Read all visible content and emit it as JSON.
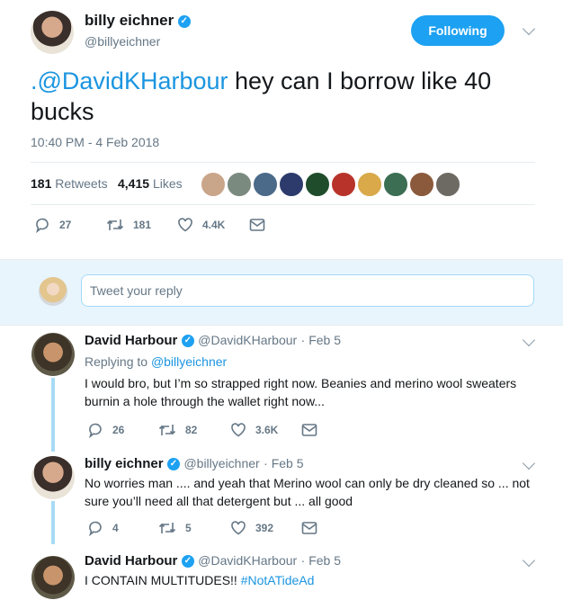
{
  "main_tweet": {
    "author_name": "billy eichner",
    "author_handle": "@billyeichner",
    "follow_button": "Following",
    "text_mention": ".@DavidKHarbour",
    "text_body": " hey can I borrow like 40 bucks",
    "timestamp": "10:40 PM - 4 Feb 2018",
    "retweets_count": "181",
    "retweets_label": "Retweets",
    "likes_count": "4,415",
    "likes_label": "Likes",
    "liker_avatar_count": 10,
    "actions": {
      "replies": "27",
      "retweets": "181",
      "likes": "4.4K"
    }
  },
  "reply_box": {
    "placeholder": "Tweet your reply"
  },
  "replies": [
    {
      "author_name": "David Harbour",
      "author_handle": "@DavidKHarbour",
      "date": "· Feb 5",
      "replying_prefix": "Replying to",
      "replying_to": "@billyeichner",
      "text": "I would bro, but I’m so strapped right now.  Beanies and merino wool sweaters burnin a hole through the wallet right now...",
      "actions": {
        "replies": "26",
        "retweets": "82",
        "likes": "3.6K"
      }
    },
    {
      "author_name": "billy eichner",
      "author_handle": "@billyeichner",
      "date": "· Feb 5",
      "text": "No worries man .... and yeah that Merino wool can only be dry cleaned so ... not sure you’ll need all that detergent but ... all good",
      "actions": {
        "replies": "4",
        "retweets": "5",
        "likes": "392"
      }
    },
    {
      "author_name": "David Harbour",
      "author_handle": "@DavidKHarbour",
      "date": "· Feb 5",
      "text": "I CONTAIN MULTITUDES!! ",
      "hashtag": "#NotATideAd"
    }
  ],
  "colors": {
    "accent": "#1da1f2",
    "link": "#1b95e0",
    "muted": "#657786",
    "divider": "#e6ecf0",
    "thread": "#a8dbf5"
  }
}
